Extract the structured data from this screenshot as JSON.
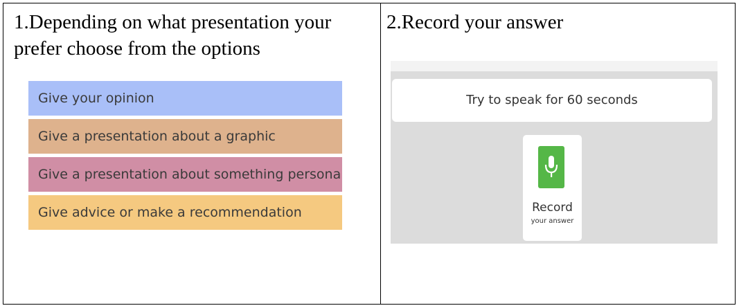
{
  "left_cell": {
    "title": "1.Depending on what presentation your prefer choose from the options",
    "options": [
      {
        "label": "Give your opinion",
        "color": "#a9bff8"
      },
      {
        "label": "Give a presentation about a graphic",
        "color": "#deb28d"
      },
      {
        "label": "Give a presentation about something personal",
        "color": "#d08ea5"
      },
      {
        "label": "Give advice or make a recommendation",
        "color": "#f5c980"
      }
    ]
  },
  "right_cell": {
    "title": "2.Record your answer",
    "prompt": "Try to speak for 60 seconds",
    "record_button": {
      "icon": "microphone-icon",
      "label": "Record",
      "sublabel": "your answer",
      "color": "#55b747"
    }
  }
}
